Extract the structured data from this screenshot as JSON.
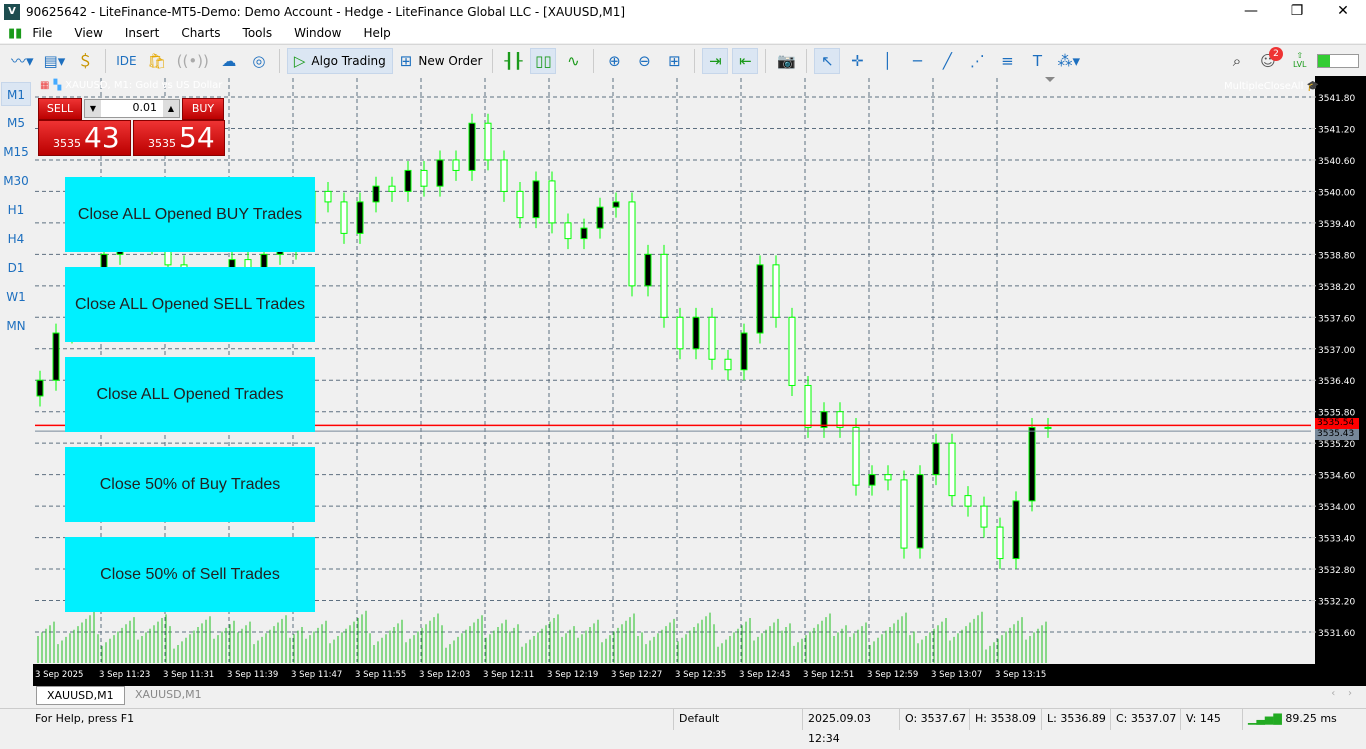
{
  "window": {
    "title": "90625642 - LiteFinance-MT5-Demo: Demo Account - Hedge - LiteFinance Global LLC - [XAUUSD,M1]",
    "logo": "V",
    "minimize": "—",
    "maximize": "❐",
    "close": "✕"
  },
  "menu": [
    "File",
    "View",
    "Insert",
    "Charts",
    "Tools",
    "Window",
    "Help"
  ],
  "toolbar": {
    "ide": "IDE",
    "algo_trading": "Algo Trading",
    "new_order": "New Order",
    "notifications": "2",
    "lvl": "LVL"
  },
  "timeframes": [
    "M1",
    "M5",
    "M15",
    "M30",
    "H1",
    "H4",
    "D1",
    "W1",
    "MN"
  ],
  "active_timeframe": "M1",
  "chart": {
    "header": "XAUUSD, M1:  Gold vs US Dollar",
    "ea_name": "MultipleCloseAll",
    "lot": "0.01",
    "sell_label": "SELL",
    "buy_label": "BUY",
    "sell_big": "3535",
    "sell_small": "43",
    "buy_big": "3535",
    "buy_small": "54",
    "bid_label": "3535.43",
    "ask_label": "3535.54",
    "ask": 3535.54,
    "bid": 3535.43
  },
  "buttons": [
    "Close ALL Opened BUY Trades",
    "Close ALL Opened SELL Trades",
    "Close ALL Opened Trades",
    "Close 50% of Buy Trades",
    "Close 50% of Sell Trades"
  ],
  "chart_data": {
    "type": "candlestick",
    "price_ticks": [
      "3541.80",
      "3541.20",
      "3540.60",
      "3540.00",
      "3539.40",
      "3538.80",
      "3538.20",
      "3537.60",
      "3537.00",
      "3536.40",
      "3535.80",
      "3535.20",
      "3534.60",
      "3534.00",
      "3533.40",
      "3532.80",
      "3532.20",
      "3531.60"
    ],
    "time_ticks": [
      "3 Sep 2025",
      "3 Sep 11:23",
      "3 Sep 11:31",
      "3 Sep 11:39",
      "3 Sep 11:47",
      "3 Sep 11:55",
      "3 Sep 12:03",
      "3 Sep 12:11",
      "3 Sep 12:19",
      "3 Sep 12:27",
      "3 Sep 12:35",
      "3 Sep 12:43",
      "3 Sep 12:51",
      "3 Sep 12:59",
      "3 Sep 13:07",
      "3 Sep 13:15"
    ],
    "closes": [
      3536.4,
      3537.3,
      3537.8,
      3538.3,
      3538.8,
      3539.3,
      3539.5,
      3539.0,
      3538.6,
      3538.2,
      3537.8,
      3538.3,
      3538.7,
      3538.5,
      3538.8,
      3538.9,
      3539.4,
      3540.0,
      3539.8,
      3539.2,
      3539.8,
      3540.1,
      3540.0,
      3540.4,
      3540.1,
      3540.6,
      3540.4,
      3541.3,
      3540.6,
      3540.0,
      3539.5,
      3540.2,
      3539.4,
      3539.1,
      3539.3,
      3539.7,
      3539.8,
      3538.2,
      3538.8,
      3537.6,
      3537.0,
      3537.6,
      3536.8,
      3536.6,
      3537.3,
      3538.6,
      3537.6,
      3536.3,
      3535.5,
      3535.8,
      3535.5,
      3534.4,
      3534.6,
      3534.5,
      3533.2,
      3534.6,
      3535.2,
      3534.2,
      3534.0,
      3533.6,
      3533.0,
      3534.1,
      3535.5,
      3535.5
    ]
  },
  "tabs": [
    "XAUUSD,M1",
    "XAUUSD,M1"
  ],
  "status": {
    "help": "For Help, press F1",
    "profile": "Default",
    "datetime": "2025.09.03 12:34",
    "open": "O: 3537.67",
    "high": "H: 3538.09",
    "low": "L: 3536.89",
    "close": "C: 3537.07",
    "volume": "V: 145",
    "ping": "89.25 ms"
  }
}
